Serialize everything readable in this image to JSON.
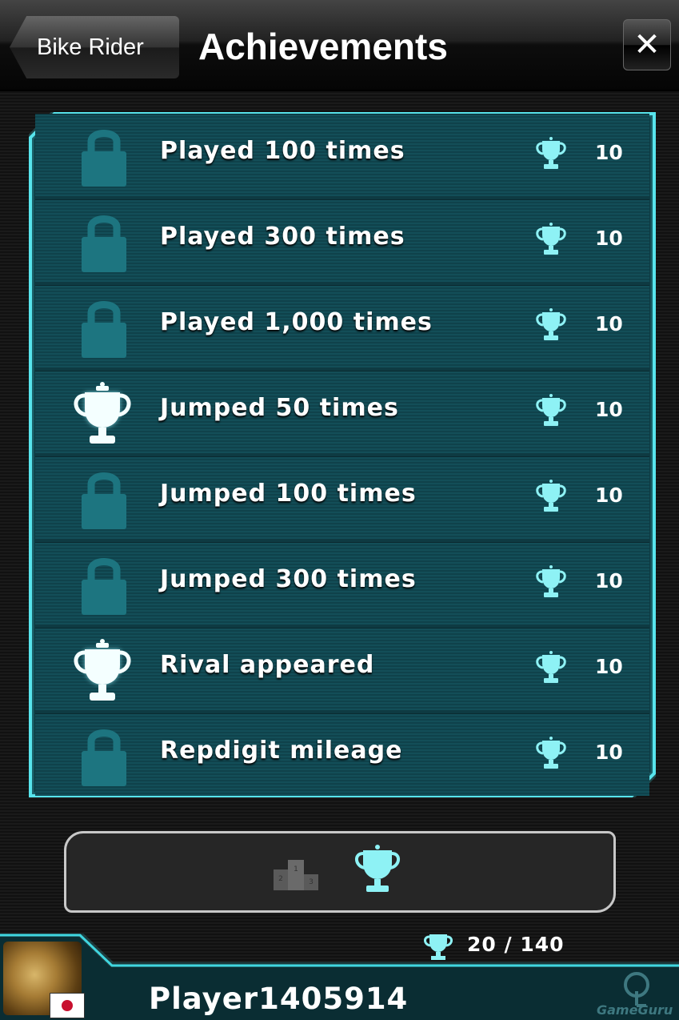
{
  "header": {
    "back_label": "Bike Rider",
    "title": "Achievements",
    "close_glyph": "✕"
  },
  "achievements": [
    {
      "label": "Played 100 times",
      "points": "10",
      "unlocked": false
    },
    {
      "label": "Played 300 times",
      "points": "10",
      "unlocked": false
    },
    {
      "label": "Played 1,000 times",
      "points": "10",
      "unlocked": false
    },
    {
      "label": "Jumped 50 times",
      "points": "10",
      "unlocked": true
    },
    {
      "label": "Jumped 100 times",
      "points": "10",
      "unlocked": false
    },
    {
      "label": "Jumped 300 times",
      "points": "10",
      "unlocked": false
    },
    {
      "label": "Rival appeared",
      "points": "10",
      "unlocked": true
    },
    {
      "label": "Repdigit mileage",
      "points": "10",
      "unlocked": false
    }
  ],
  "tabs": [
    {
      "name": "leaderboards",
      "icon": "podium-icon",
      "active": false
    },
    {
      "name": "achievements",
      "icon": "trophy-icon",
      "active": true
    }
  ],
  "footer": {
    "score": "20 / 140",
    "player_name": "Player1405914",
    "flag": "japan-flag-icon"
  },
  "watermark": {
    "text": "GameGuru"
  },
  "colors": {
    "accent": "#3fd6e0",
    "panel": "#0e3a42",
    "row": "#134e58",
    "lock": "#1d7580"
  }
}
